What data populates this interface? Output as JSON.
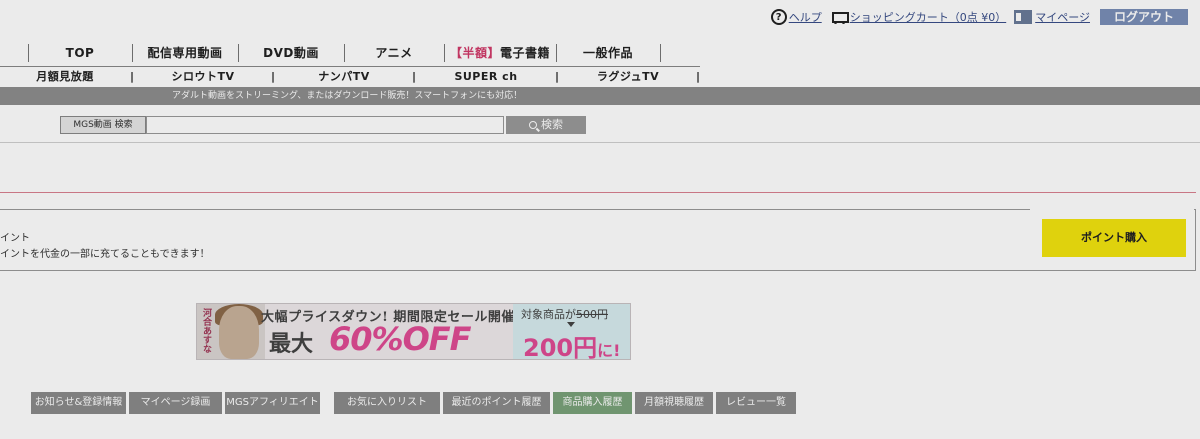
{
  "header": {
    "help_label": "ヘルプ",
    "cart_label": "ショッピングカート（0点 ¥0）",
    "mypage_label": "マイページ",
    "logout_label": "ログアウト"
  },
  "nav": {
    "main": [
      "TOP",
      "配信専用動画",
      "DVD動画",
      "アニメ",
      "電子書籍",
      "一般作品"
    ],
    "ebook_prefix": "【半額】",
    "sub": [
      "月額見放題",
      "シロウトTV",
      "ナンパTV",
      "SUPER ch",
      "ラグジュTV"
    ]
  },
  "notice": "アダルト動画をストリーミング、またはダウンロード販売！スマートフォンにも対応！",
  "search": {
    "label": "MGS動画 検索",
    "value": "",
    "button_label": "検索"
  },
  "points": {
    "line1": "イント",
    "line2": "イントを代金の一部に充てることもできます！",
    "buy_label": "ポイント購入"
  },
  "banner": {
    "model_name": "河合あすな",
    "headline": "大幅プライスダウン! 期間限定セール開催中",
    "big_prefix": "最大",
    "big_offer": "60%OFF",
    "target_label": "対象商品が",
    "old_price": "500円",
    "new_price": "200円",
    "new_price_suffix": "に!"
  },
  "tabs": [
    "お知らせ&登録情報",
    "マイページ録画",
    "MGSアフィリエイト",
    "お気に入りリスト",
    "最近のポイント履歴",
    "商品購入履歴",
    "月額視聴履歴",
    "レビュー一覧"
  ],
  "colors": {
    "accent_yellow": "#f2e40f",
    "active_tab": "#7aa27a",
    "brand_pink": "#e04b94",
    "logout_blue": "#7a8fb8"
  }
}
